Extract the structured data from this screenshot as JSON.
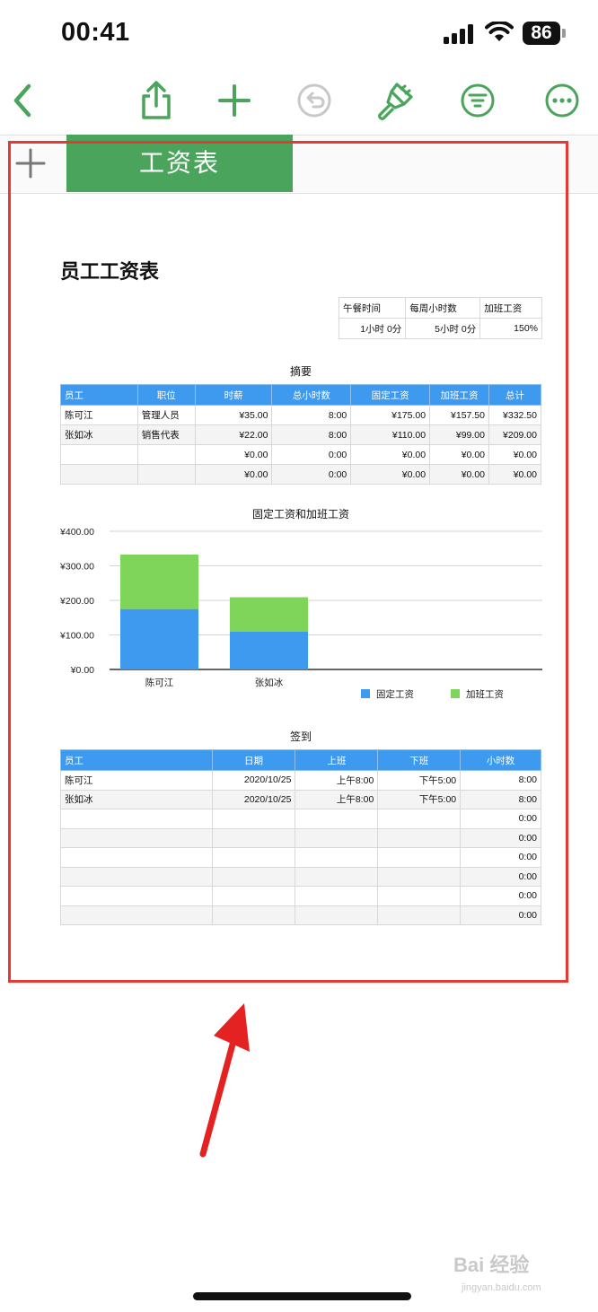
{
  "status_bar": {
    "time": "00:41",
    "battery": "86"
  },
  "toolbar": {
    "icons": [
      "back-chevron-icon",
      "share-icon",
      "add-icon",
      "undo-icon",
      "format-brush-icon",
      "filter-icon",
      "more-icon"
    ],
    "accent": "#4aa45c"
  },
  "sheet_tab": {
    "label": "工资表"
  },
  "document": {
    "title": "员工工资表",
    "info_table": {
      "headers": [
        "午餐时间",
        "每周小时数",
        "加班工资"
      ],
      "values": [
        "1小时 0分",
        "5小时 0分",
        "150%"
      ]
    },
    "summary": {
      "caption": "摘要",
      "headers": [
        "员工",
        "职位",
        "时薪",
        "总小时数",
        "固定工资",
        "加班工资",
        "总计"
      ],
      "rows": [
        [
          "陈可江",
          "管理人员",
          "¥35.00",
          "8:00",
          "¥175.00",
          "¥157.50",
          "¥332.50"
        ],
        [
          "张如冰",
          "销售代表",
          "¥22.00",
          "8:00",
          "¥110.00",
          "¥99.00",
          "¥209.00"
        ],
        [
          "",
          "",
          "¥0.00",
          "0:00",
          "¥0.00",
          "¥0.00",
          "¥0.00"
        ],
        [
          "",
          "",
          "¥0.00",
          "0:00",
          "¥0.00",
          "¥0.00",
          "¥0.00"
        ]
      ]
    },
    "signin": {
      "caption": "签到",
      "headers": [
        "员工",
        "日期",
        "上班",
        "下班",
        "小时数"
      ],
      "rows": [
        [
          "陈可江",
          "2020/10/25",
          "上午8:00",
          "下午5:00",
          "8:00"
        ],
        [
          "张如冰",
          "2020/10/25",
          "上午8:00",
          "下午5:00",
          "8:00"
        ],
        [
          "",
          "",
          "",
          "",
          "0:00"
        ],
        [
          "",
          "",
          "",
          "",
          "0:00"
        ],
        [
          "",
          "",
          "",
          "",
          "0:00"
        ],
        [
          "",
          "",
          "",
          "",
          "0:00"
        ],
        [
          "",
          "",
          "",
          "",
          "0:00"
        ],
        [
          "",
          "",
          "",
          "",
          "0:00"
        ]
      ]
    }
  },
  "chart_data": {
    "type": "bar",
    "stacked": true,
    "title": "固定工资和加班工资",
    "categories": [
      "陈可江",
      "张如冰"
    ],
    "series": [
      {
        "name": "固定工资",
        "values": [
          175,
          110
        ],
        "color": "#3d9aee"
      },
      {
        "name": "加班工资",
        "values": [
          157.5,
          99
        ],
        "color": "#7fd45a"
      }
    ],
    "yticks": [
      "¥0.00",
      "¥100.00",
      "¥200.00",
      "¥300.00",
      "¥400.00"
    ],
    "ylim": [
      0,
      400
    ],
    "grid": true,
    "legend": "bottom-right"
  },
  "watermark": {
    "brand": "Bai 经验",
    "url": "jingyan.baidu.com"
  },
  "annotation_colors": {
    "box": "#e53935",
    "arrow": "#e52222"
  }
}
